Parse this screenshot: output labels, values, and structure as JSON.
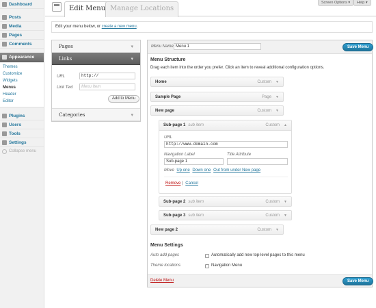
{
  "sidebar": {
    "items": [
      {
        "label": "Dashboard",
        "icon": "dashboard-icon"
      },
      {
        "label": "Posts",
        "icon": "posts-icon"
      },
      {
        "label": "Media",
        "icon": "media-icon"
      },
      {
        "label": "Pages",
        "icon": "pages-icon"
      },
      {
        "label": "Comments",
        "icon": "comments-icon"
      },
      {
        "label": "Appearance",
        "icon": "appearance-icon"
      },
      {
        "label": "Plugins",
        "icon": "plugins-icon"
      },
      {
        "label": "Users",
        "icon": "users-icon"
      },
      {
        "label": "Tools",
        "icon": "tools-icon"
      },
      {
        "label": "Settings",
        "icon": "settings-icon"
      }
    ],
    "appearance_sub": [
      "Themes",
      "Customize",
      "Widgets",
      "Menus",
      "Header",
      "Editor"
    ],
    "collapse_label": "Collapse menu"
  },
  "header": {
    "screen_options": "Screen Options ▾",
    "help": "Help ▾",
    "tab_edit": "Edit Menus",
    "tab_locations": "Manage Locations"
  },
  "notice": {
    "text": "Edit your menu below, or ",
    "link": "create a new menu",
    "end": "."
  },
  "accordion": {
    "pages": "Pages",
    "links": "Links",
    "categories": "Categories",
    "url_label": "URL",
    "url_value": "http://",
    "link_text_label": "Link Text",
    "link_text_placeholder": "Menu Item",
    "add_button": "Add to Menu"
  },
  "menu": {
    "name_label": "Menu Name",
    "name_value": "Menu 1",
    "save_button": "Save Menu",
    "structure_title": "Menu Structure",
    "structure_desc": "Drag each item into the order you prefer. Click an item to reveal additional configuration options.",
    "items": [
      {
        "title": "Home",
        "sub": "",
        "type": "Custom"
      },
      {
        "title": "Sample Page",
        "sub": "",
        "type": "Page"
      },
      {
        "title": "New page",
        "sub": "",
        "type": "Custom"
      },
      {
        "title": "Sub-page 1",
        "sub": "sub item",
        "type": "Custom"
      },
      {
        "title": "Sub-page 2",
        "sub": "sub item",
        "type": "Custom"
      },
      {
        "title": "Sub-page 3",
        "sub": "sub item",
        "type": "Custom"
      },
      {
        "title": "New page 2",
        "sub": "",
        "type": "Custom"
      }
    ],
    "edit": {
      "url_label": "URL",
      "url_value": "http://www.domain.com",
      "nav_label": "Navigation Label",
      "nav_value": "Sub-page 1",
      "title_attr_label": "Title Attribute",
      "move_label": "Move",
      "move_up": "Up one",
      "move_down": "Down one",
      "move_out": "Out from under New page",
      "remove": "Remove",
      "separator": "|",
      "cancel": "Cancel"
    },
    "settings_title": "Menu Settings",
    "auto_add_label": "Auto add pages",
    "auto_add_text": "Automatically add new top-level pages to this menu",
    "theme_loc_label": "Theme locations",
    "theme_loc_text": "Navigation Menu",
    "delete": "Delete Menu"
  }
}
